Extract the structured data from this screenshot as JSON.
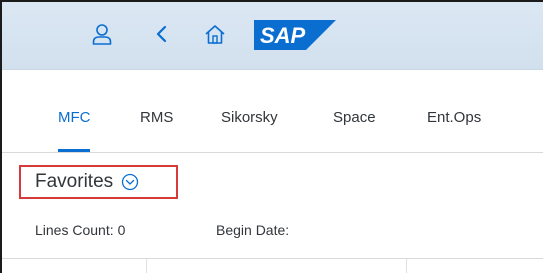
{
  "shell": {
    "logo_text": "SAP",
    "colors": {
      "background": "#d6e3f0",
      "icon": "#0a6ed1",
      "logo": "#0a6ed1"
    },
    "icons": [
      "user-icon",
      "back-icon",
      "home-icon"
    ]
  },
  "tabs": [
    {
      "label": "MFC",
      "active": true
    },
    {
      "label": "RMS",
      "active": false
    },
    {
      "label": "Sikorsky",
      "active": false
    },
    {
      "label": "Space",
      "active": false
    },
    {
      "label": "Ent.Ops",
      "active": false
    }
  ],
  "favorites": {
    "title": "Favorites",
    "highlight_color": "#d63a3a"
  },
  "stats": {
    "lines_count_label": "Lines Count:",
    "lines_count_value": "0",
    "begin_date_label": "Begin Date:",
    "begin_date_value": ""
  }
}
